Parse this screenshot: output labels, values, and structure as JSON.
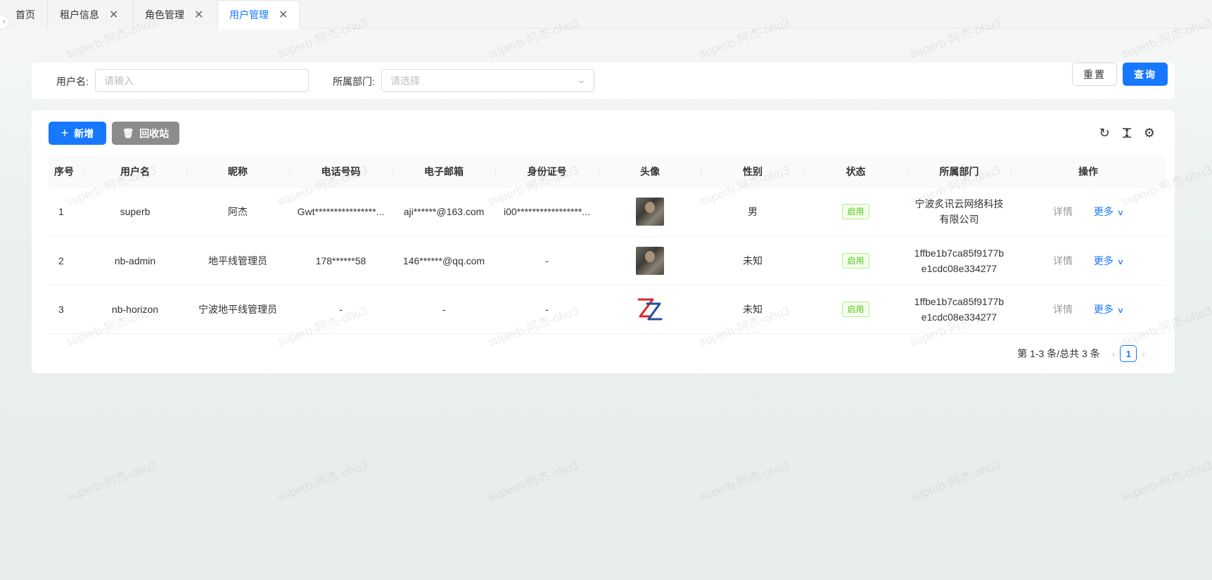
{
  "tabs": [
    {
      "label": "首页",
      "closable": false,
      "active": false
    },
    {
      "label": "租户信息",
      "closable": true,
      "active": false
    },
    {
      "label": "角色管理",
      "closable": true,
      "active": false
    },
    {
      "label": "用户管理",
      "closable": true,
      "active": true
    }
  ],
  "watermark": "superb-阿杰-ohu3",
  "search": {
    "username_label": "用户名:",
    "username_placeholder": "请输入",
    "dept_label": "所属部门:",
    "dept_placeholder": "请选择",
    "reset_label": "重置",
    "query_label": "查询"
  },
  "toolbar": {
    "add_label": "新增",
    "recycle_label": "回收站",
    "icons": [
      "refresh-icon",
      "column-height-icon",
      "settings-icon"
    ]
  },
  "table": {
    "columns": [
      "序号",
      "用户名",
      "昵称",
      "电话号码",
      "电子邮箱",
      "身份证号",
      "头像",
      "性别",
      "状态",
      "所属部门",
      "操作"
    ],
    "rows": [
      {
        "index": "1",
        "username": "superb",
        "nickname": "阿杰",
        "phone": "Gwt****************...",
        "email": "aji******@163.com",
        "idcard": "i00*****************...",
        "avatar": "photo",
        "gender": "男",
        "status": "启用",
        "dept": "宁波炙讯云网络科技有限公司",
        "detail": "详情",
        "more": "更多"
      },
      {
        "index": "2",
        "username": "nb-admin",
        "nickname": "地平线管理员",
        "phone": "178******58",
        "email": "146******@qq.com",
        "idcard": "-",
        "avatar": "photo",
        "gender": "未知",
        "status": "启用",
        "dept": "1ffbe1b7ca85f9177be1cdc08e334277",
        "detail": "详情",
        "more": "更多"
      },
      {
        "index": "3",
        "username": "nb-horizon",
        "nickname": "宁波地平线管理员",
        "phone": "-",
        "email": "-",
        "idcard": "-",
        "avatar": "logo",
        "gender": "未知",
        "status": "启用",
        "dept": "1ffbe1b7ca85f9177be1cdc08e334277",
        "detail": "详情",
        "more": "更多"
      }
    ]
  },
  "pagination": {
    "summary": "第 1-3 条/总共 3 条",
    "current_page": "1"
  },
  "colors": {
    "primary": "#1677ff",
    "success": "#52c41a",
    "gray_button": "#8c8c8c"
  }
}
